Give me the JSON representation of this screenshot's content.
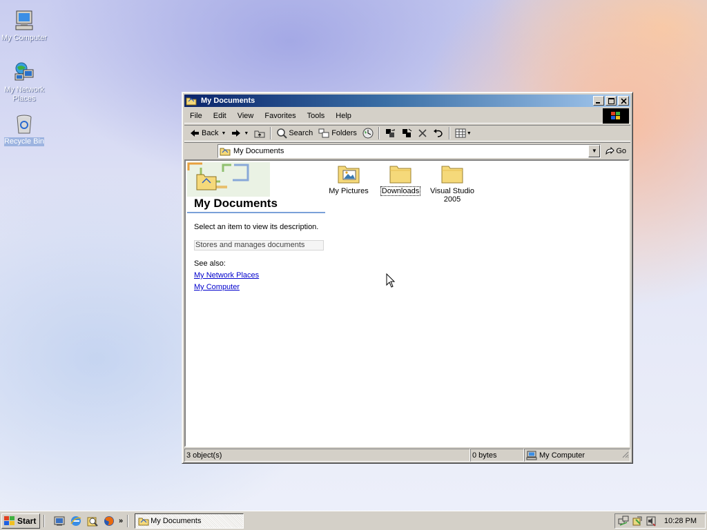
{
  "desktop": {
    "icons": [
      {
        "label": "My Computer"
      },
      {
        "label": "My Network Places"
      },
      {
        "label": "Recycle Bin"
      }
    ]
  },
  "window": {
    "title": "My Documents",
    "menu": [
      "File",
      "Edit",
      "View",
      "Favorites",
      "Tools",
      "Help"
    ],
    "toolbar": {
      "back": "Back",
      "search": "Search",
      "folders": "Folders"
    },
    "address": {
      "value": "My Documents",
      "go": "Go"
    },
    "webview": {
      "heading": "My Documents",
      "prompt": "Select an item to view its description.",
      "info": "Stores and manages documents",
      "see_also": "See also:",
      "links": [
        "My Network Places",
        "My Computer"
      ]
    },
    "items": [
      {
        "label": "My Pictures",
        "icon": "pictures-folder-icon"
      },
      {
        "label": "Downloads",
        "icon": "folder-icon"
      },
      {
        "label": "Visual Studio 2005",
        "icon": "folder-icon"
      }
    ],
    "status": {
      "objects": "3 object(s)",
      "size": "0 bytes",
      "zone": "My Computer"
    }
  },
  "taskbar": {
    "start": "Start",
    "more": "»",
    "task": "My Documents",
    "clock": "10:28 PM"
  },
  "colors": {
    "title_active": "#0a246a",
    "title_gradient_end": "#a6caf0",
    "link": "#0000cc",
    "folder": "#f5d97a"
  }
}
